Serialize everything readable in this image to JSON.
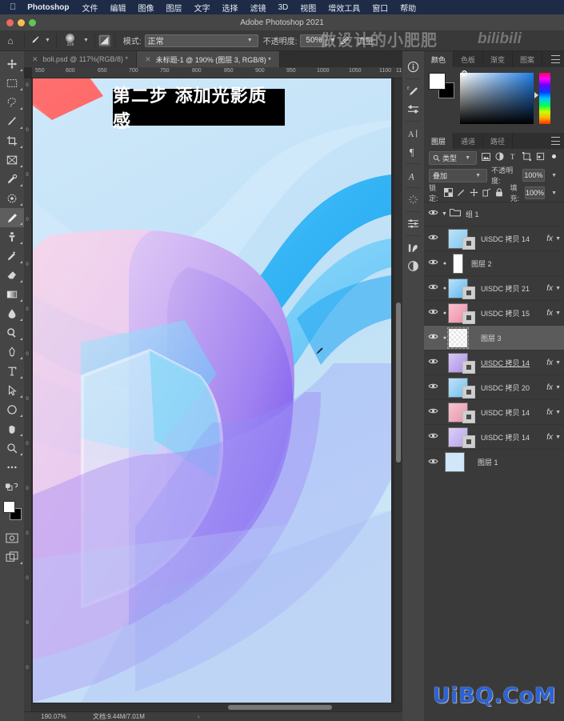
{
  "macbar": {
    "apple": "apple-logo",
    "app_name": "Photoshop",
    "menus": [
      "文件",
      "编辑",
      "图像",
      "图层",
      "文字",
      "选择",
      "滤镜",
      "3D",
      "视图",
      "增效工具",
      "窗口",
      "帮助"
    ]
  },
  "window": {
    "title": "Adobe Photoshop 2021"
  },
  "options_bar": {
    "home_icon": "home-icon",
    "brush_preset_size": "219",
    "mode_label": "模式:",
    "mode_value": "正常",
    "opacity_label": "不透明度:",
    "opacity_value": "50%",
    "flow_label": "流量:"
  },
  "watermarks": {
    "channel_cn": "做设计的小肥肥",
    "bilibili": "bilibili",
    "site": "UiBQ.CoM"
  },
  "tabs": [
    {
      "label": "boli.psd @ 117%(RGB/8) *",
      "active": false
    },
    {
      "label": "未标题-1 @ 190% (图层 3, RGB/8) *",
      "active": true
    }
  ],
  "toolbox": [
    {
      "name": "move-tool",
      "active": false
    },
    {
      "name": "rectangular-marquee-tool",
      "active": false
    },
    {
      "name": "lasso-tool",
      "active": false
    },
    {
      "name": "quick-selection-tool",
      "active": false
    },
    {
      "name": "crop-tool",
      "active": false
    },
    {
      "name": "frame-tool",
      "active": false
    },
    {
      "name": "eyedropper-tool",
      "active": false
    },
    {
      "name": "spot-healing-brush-tool",
      "active": false
    },
    {
      "name": "brush-tool",
      "active": true
    },
    {
      "name": "clone-stamp-tool",
      "active": false
    },
    {
      "name": "history-brush-tool",
      "active": false
    },
    {
      "name": "eraser-tool",
      "active": false
    },
    {
      "name": "gradient-tool",
      "active": false
    },
    {
      "name": "blur-tool",
      "active": false
    },
    {
      "name": "dodge-tool",
      "active": false
    },
    {
      "name": "pen-tool",
      "active": false
    },
    {
      "name": "type-tool",
      "active": false
    },
    {
      "name": "path-selection-tool",
      "active": false
    },
    {
      "name": "ellipse-shape-tool",
      "active": false
    },
    {
      "name": "hand-tool",
      "active": false
    },
    {
      "name": "zoom-tool",
      "active": false
    },
    {
      "name": "edit-toolbar-tool",
      "active": false
    }
  ],
  "canvas": {
    "ruler_ticks": [
      "550",
      "600",
      "650",
      "700",
      "750",
      "800",
      "850",
      "900",
      "950",
      "1000",
      "1050",
      "1100",
      "11"
    ],
    "ruler_v_ticks": [
      "0",
      "0",
      "0",
      "0",
      "0",
      "0",
      "0",
      "0",
      "0",
      "0",
      "0",
      "0",
      "0",
      "0"
    ],
    "overlay_banner": "第二步 添加光影质感",
    "bg_color": "#bfe0f5"
  },
  "statusbar": {
    "zoom": "190.07%",
    "doc_info": "文档:9.44M/7.01M",
    "arrow": "›"
  },
  "dock_rail": [
    {
      "name": "info-panel-icon",
      "glyph": "ⓘ"
    },
    {
      "name": "brush-settings-icon",
      "glyph": "✎"
    },
    {
      "name": "adjustments-icon",
      "glyph": "⇌"
    },
    {
      "name": "character-panel-icon",
      "glyph": "A"
    },
    {
      "name": "paragraph-panel-icon",
      "glyph": "¶"
    },
    {
      "name": "glyphs-panel-icon",
      "glyph": "A"
    },
    {
      "name": "libraries-panel-icon",
      "glyph": "✳"
    },
    {
      "name": "properties-panel-icon",
      "glyph": "≡"
    },
    {
      "name": "histogram-panel-icon",
      "glyph": "⌇"
    },
    {
      "name": "adjustment-layer-icon",
      "glyph": "◐"
    }
  ],
  "color_panel": {
    "tabs": [
      {
        "label": "颜色",
        "active": true
      },
      {
        "label": "色板",
        "active": false
      },
      {
        "label": "渐变",
        "active": false
      },
      {
        "label": "图案",
        "active": false
      }
    ],
    "foreground": "#ffffff",
    "background": "#000000"
  },
  "layers_panel": {
    "tabs": [
      {
        "label": "图层",
        "active": true
      },
      {
        "label": "通道",
        "active": false
      },
      {
        "label": "路径",
        "active": false
      }
    ],
    "filter_label": "类型",
    "filter_icons": [
      "pixel-filter-icon",
      "adjustment-filter-icon",
      "type-filter-icon",
      "shape-filter-icon",
      "smart-object-filter-icon"
    ],
    "filter_toggle": "filter-toggle-icon",
    "blend_mode": "叠加",
    "opacity_label": "不透明度:",
    "opacity_value": "100%",
    "lock_label": "锁定:",
    "lock_icons": [
      "lock-transparent-icon",
      "lock-image-icon",
      "lock-position-icon",
      "lock-artboard-icon",
      "lock-all-icon"
    ],
    "fill_label": "填充:",
    "fill_value": "100%",
    "layers": [
      {
        "name": "组 1",
        "type": "group",
        "visible": true,
        "fx": false,
        "selected": false,
        "expanded": true,
        "linked": false,
        "thumb_colors": [
          "#cfcfcf",
          "#cfcfcf"
        ]
      },
      {
        "name": "UISDC 拷贝 14",
        "type": "layer",
        "visible": true,
        "fx": true,
        "selected": false,
        "underline": false,
        "linked": false,
        "thumb_colors": [
          "#bfe2f7",
          "#7ec8f0"
        ]
      },
      {
        "name": "图层 2",
        "type": "layer",
        "visible": true,
        "fx": false,
        "selected": false,
        "underline": false,
        "linked": true,
        "thumb_colors": [
          "#ffffff",
          "#f2f2f2"
        ]
      },
      {
        "name": "UISDC 拷贝 21",
        "type": "layer",
        "visible": true,
        "fx": true,
        "selected": false,
        "underline": false,
        "linked": true,
        "thumb_colors": [
          "#b9e2f8",
          "#5fb6ec"
        ]
      },
      {
        "name": "UISDC 拷贝 15",
        "type": "layer",
        "visible": true,
        "fx": true,
        "selected": false,
        "underline": false,
        "linked": true,
        "thumb_colors": [
          "#f8c2cf",
          "#ef8ba4"
        ]
      },
      {
        "name": "图层 3",
        "type": "layer",
        "visible": true,
        "fx": false,
        "selected": true,
        "underline": false,
        "linked": true,
        "thumb_colors": [
          "#e8e8e8",
          "#d6d6d6"
        ]
      },
      {
        "name": "UISDC 拷贝 14",
        "type": "layer",
        "visible": true,
        "fx": true,
        "selected": false,
        "underline": true,
        "linked": false,
        "thumb_colors": [
          "#d9c9f5",
          "#a98de6"
        ]
      },
      {
        "name": "UISDC 拷贝 20",
        "type": "layer",
        "visible": true,
        "fx": true,
        "selected": false,
        "underline": false,
        "linked": false,
        "thumb_colors": [
          "#bfe2f7",
          "#6fc0ee"
        ]
      },
      {
        "name": "UISDC 拷贝 14",
        "type": "layer",
        "visible": true,
        "fx": true,
        "selected": false,
        "underline": false,
        "linked": false,
        "thumb_colors": [
          "#f6c4d0",
          "#e895ab"
        ]
      },
      {
        "name": "UISDC 拷贝 14",
        "type": "layer",
        "visible": true,
        "fx": true,
        "selected": false,
        "underline": false,
        "linked": false,
        "thumb_colors": [
          "#ddd0f6",
          "#b6a0ea"
        ]
      },
      {
        "name": "图层 1",
        "type": "layer",
        "visible": true,
        "fx": false,
        "selected": false,
        "underline": false,
        "linked": false,
        "thumb_colors": [
          "#cfe7f8",
          "#cfe7f8"
        ]
      }
    ]
  }
}
